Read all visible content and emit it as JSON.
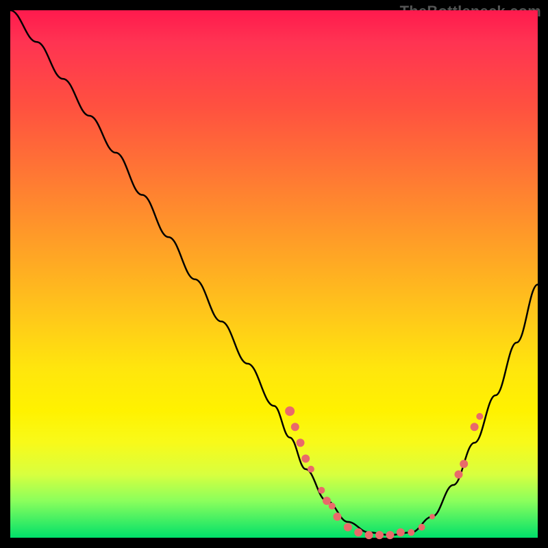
{
  "watermark": "TheBottleneck.com",
  "chart_data": {
    "type": "line",
    "title": "",
    "xlabel": "",
    "ylabel": "",
    "xlim": [
      0,
      100
    ],
    "ylim": [
      0,
      100
    ],
    "grid": false,
    "legend": false,
    "gradient_stops": [
      {
        "pos": 0,
        "color": "#ff1a4d"
      },
      {
        "pos": 18,
        "color": "#ff5040"
      },
      {
        "pos": 45,
        "color": "#ffa126"
      },
      {
        "pos": 68,
        "color": "#ffe60d"
      },
      {
        "pos": 88,
        "color": "#d8ff3f"
      },
      {
        "pos": 100,
        "color": "#00e06a"
      }
    ],
    "series": [
      {
        "name": "bottleneck-curve",
        "x": [
          0,
          5,
          10,
          15,
          20,
          25,
          30,
          35,
          40,
          45,
          50,
          53,
          56,
          60,
          64,
          68,
          72,
          76,
          80,
          84,
          88,
          92,
          96,
          100
        ],
        "y": [
          100,
          94,
          87,
          80,
          73,
          65,
          57,
          49,
          41,
          33,
          25,
          19,
          13,
          7,
          3,
          1,
          0.5,
          1,
          4,
          10,
          18,
          27,
          37,
          48
        ]
      }
    ],
    "scatter_points": {
      "name": "marked-points",
      "color": "#e96a6a",
      "points": [
        {
          "x": 53,
          "y": 24,
          "r": 7
        },
        {
          "x": 54,
          "y": 21,
          "r": 6
        },
        {
          "x": 55,
          "y": 18,
          "r": 6
        },
        {
          "x": 56,
          "y": 15,
          "r": 6
        },
        {
          "x": 57,
          "y": 13,
          "r": 5
        },
        {
          "x": 59,
          "y": 9,
          "r": 5
        },
        {
          "x": 60,
          "y": 7,
          "r": 6
        },
        {
          "x": 61,
          "y": 6,
          "r": 5
        },
        {
          "x": 62,
          "y": 4,
          "r": 6
        },
        {
          "x": 64,
          "y": 2,
          "r": 6
        },
        {
          "x": 66,
          "y": 1,
          "r": 6
        },
        {
          "x": 68,
          "y": 0.5,
          "r": 6
        },
        {
          "x": 70,
          "y": 0.5,
          "r": 6
        },
        {
          "x": 72,
          "y": 0.5,
          "r": 6
        },
        {
          "x": 74,
          "y": 1,
          "r": 6
        },
        {
          "x": 76,
          "y": 1,
          "r": 5
        },
        {
          "x": 78,
          "y": 2,
          "r": 5
        },
        {
          "x": 80,
          "y": 4,
          "r": 4
        },
        {
          "x": 85,
          "y": 12,
          "r": 6
        },
        {
          "x": 86,
          "y": 14,
          "r": 6
        },
        {
          "x": 88,
          "y": 21,
          "r": 6
        },
        {
          "x": 89,
          "y": 23,
          "r": 5
        }
      ]
    }
  }
}
